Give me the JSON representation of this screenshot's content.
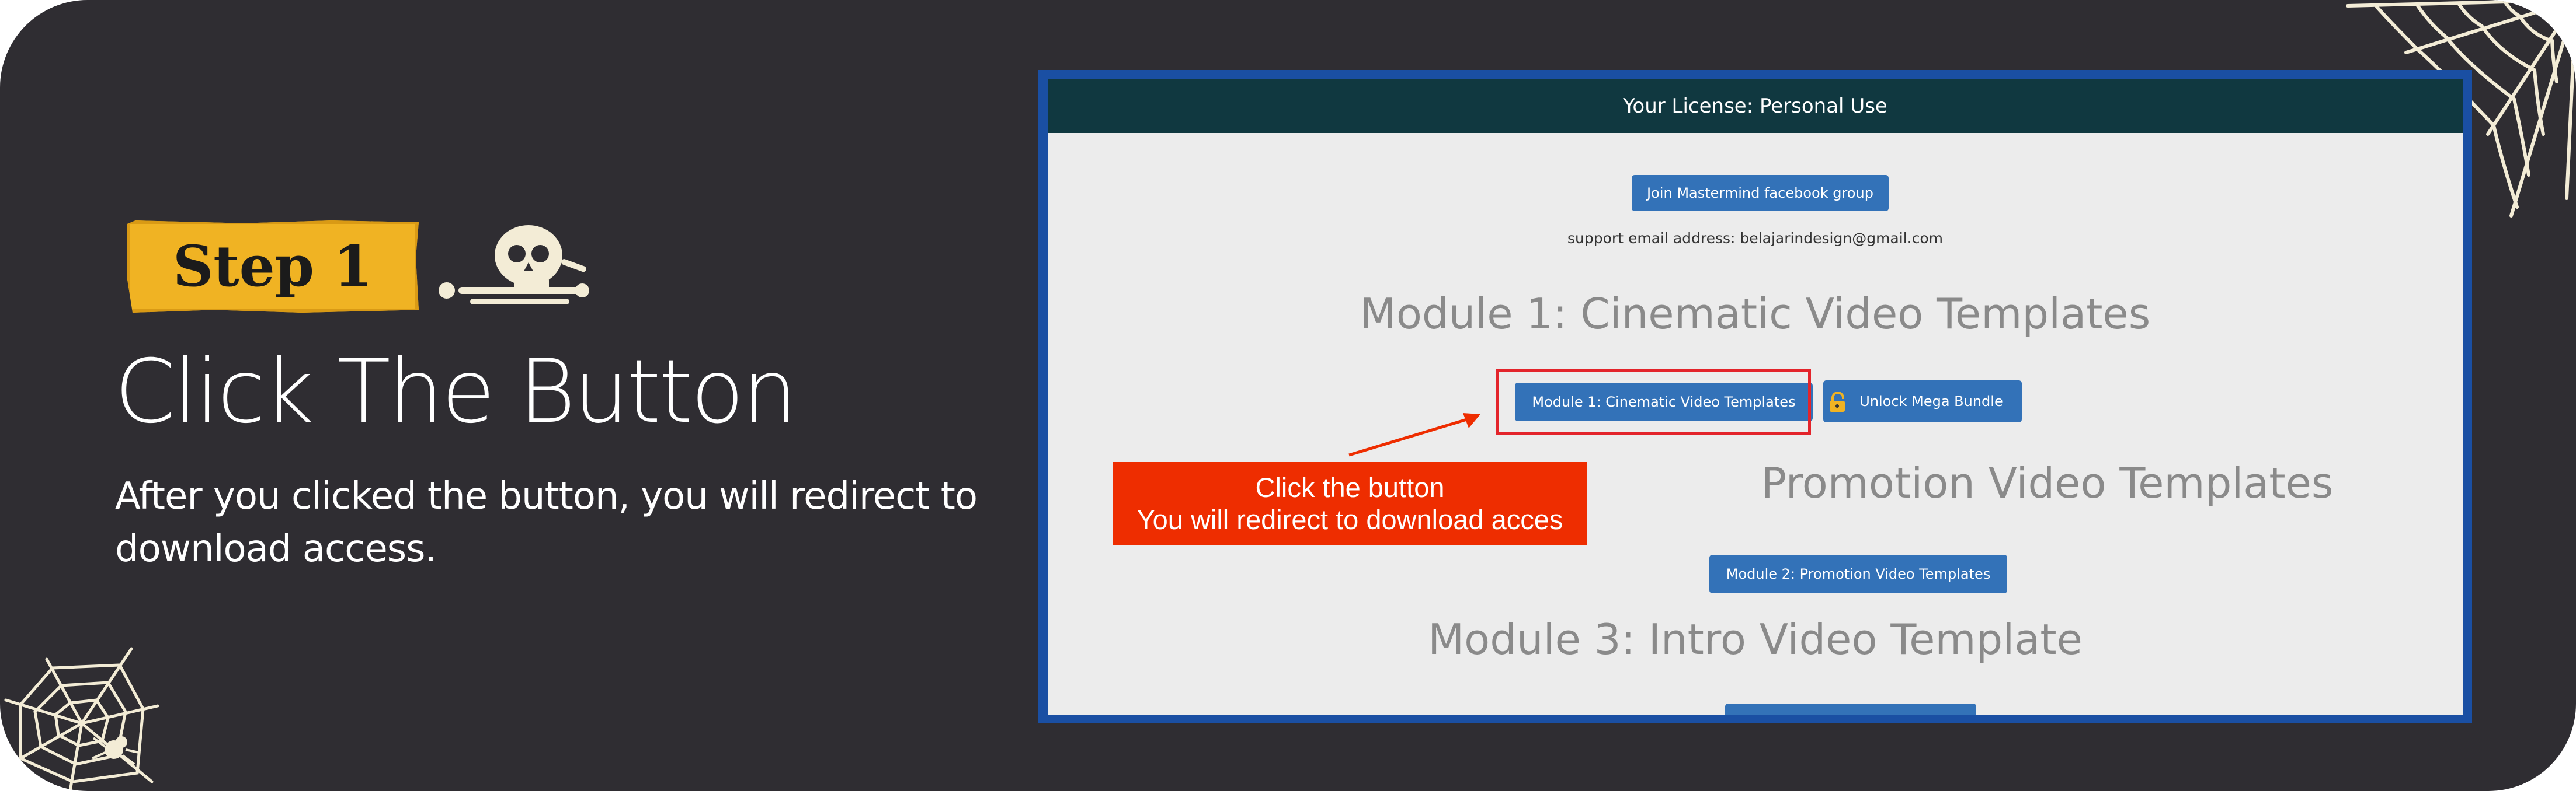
{
  "hero": {
    "step_label": "Step 1",
    "title": "Click The Button",
    "description": "After you clicked the button, you will redirect to download access."
  },
  "screenshot": {
    "license_text": "Your License: Personal Use",
    "join_button": "Join Mastermind facebook group",
    "support_text": "support email address: belajarindesign@gmail.com",
    "module1_heading": "Module 1: Cinematic Video Templates",
    "module1_button": "Module 1: Cinematic Video Templates",
    "unlock_button": "Unlock Mega Bundle",
    "module2_heading": "Promotion Video Templates",
    "module2_button": "Module 2: Promotion Video Templates",
    "module3_heading": "Module 3: Intro Video Template",
    "callout_line1": "Click the button",
    "callout_line2": "You will redirect to download acces"
  },
  "colors": {
    "card_bg": "#2f2d32",
    "badge": "#f0b323",
    "button_blue": "#3372b8",
    "callout_red": "#ee2d00",
    "license_bar": "#103840"
  },
  "icons": [
    "skeleton-icon",
    "spider-web-icon",
    "lock-icon",
    "arrow-icon"
  ]
}
